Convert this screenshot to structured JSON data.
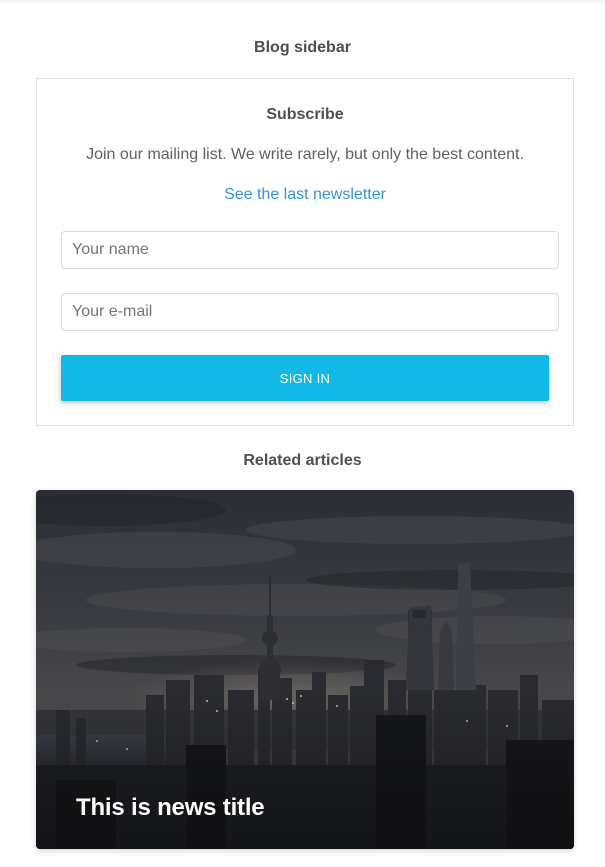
{
  "sidebar": {
    "title": "Blog sidebar"
  },
  "subscribe": {
    "heading": "Subscribe",
    "description": "Join our mailing list. We write rarely, but only the best content.",
    "newsletter_link": "See the last newsletter",
    "name_placeholder": "Your name",
    "email_placeholder": "Your e-mail",
    "button_label": "SIGN IN",
    "colors": {
      "button": "#12b8e6",
      "link": "#3592d8"
    }
  },
  "related": {
    "title": "Related articles",
    "articles": [
      {
        "title": "This is news title",
        "image": "night-city-skyline"
      }
    ]
  }
}
